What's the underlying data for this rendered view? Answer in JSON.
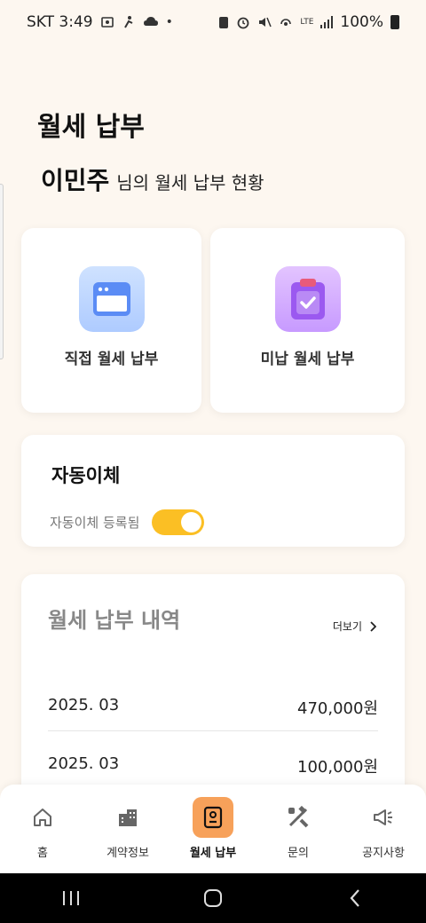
{
  "status_bar": {
    "carrier_time": "SKT 3:49",
    "battery": "100%",
    "network": "LTE"
  },
  "page": {
    "title": "월세 납부",
    "user_name": "이민주",
    "greeting_suffix": "님의 월세 납부 현황"
  },
  "actions": {
    "direct_label": "직접 월세 납부",
    "unpaid_label": "미납 월세 납부"
  },
  "auto_transfer": {
    "title": "자동이체",
    "status_label": "자동이체 등록됨",
    "enabled": true
  },
  "history": {
    "title": "월세 납부 내역",
    "more_label": "더보기",
    "rows": [
      {
        "date": "2025. 03",
        "amount": "470,000원"
      },
      {
        "date": "2025. 03",
        "amount": "100,000원"
      }
    ]
  },
  "bottom_nav": {
    "items": [
      {
        "label": "홈",
        "icon": "home-icon"
      },
      {
        "label": "계약정보",
        "icon": "building-icon"
      },
      {
        "label": "월세 납부",
        "icon": "contract-icon",
        "active": true
      },
      {
        "label": "문의",
        "icon": "tools-icon"
      },
      {
        "label": "공지사항",
        "icon": "megaphone-icon"
      }
    ]
  },
  "colors": {
    "background": "#fdf7f0",
    "accent_orange": "#f7a15a",
    "toggle_yellow": "#fbbf24",
    "direct_icon_blue": "#aecbff",
    "unpaid_icon_purple": "#c79aff"
  }
}
